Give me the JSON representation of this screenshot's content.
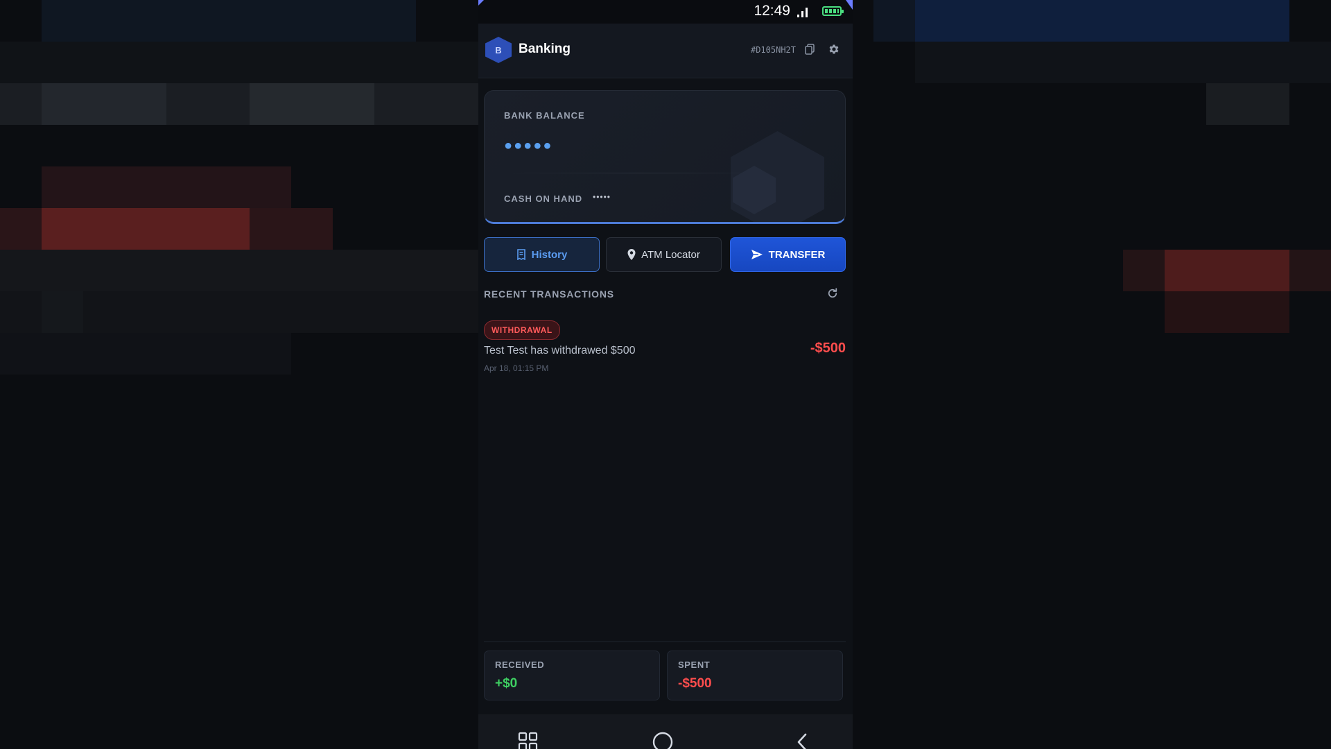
{
  "status_bar": {
    "time": "12:49"
  },
  "header": {
    "logo_letter": "B",
    "title": "Banking",
    "account_id": "#D105NH2T"
  },
  "balance_card": {
    "bank_balance_label": "BANK BALANCE",
    "bank_balance_value": "●●●●●",
    "cash_label": "CASH ON HAND",
    "cash_value": "•••••"
  },
  "tabs": [
    {
      "label": "History",
      "icon": "receipt-icon",
      "active": true
    },
    {
      "label": "ATM Locator",
      "icon": "map-pin-icon",
      "active": false
    },
    {
      "label": "TRANSFER",
      "icon": "send-icon",
      "active": false
    }
  ],
  "transactions": {
    "title": "RECENT TRANSACTIONS",
    "items": [
      {
        "type": "WITHDRAWAL",
        "description": "Test Test has withdrawed $500",
        "date": "Apr 18, 01:15 PM",
        "amount": "-$500"
      }
    ]
  },
  "stats": {
    "received_label": "RECEIVED",
    "received_value": "+$0",
    "spent_label": "SPENT",
    "spent_value": "-$500"
  },
  "colors": {
    "accent": "#2f66e8",
    "positive": "#3ecf62",
    "negative": "#ff4d4d",
    "background": "#0e1116"
  }
}
